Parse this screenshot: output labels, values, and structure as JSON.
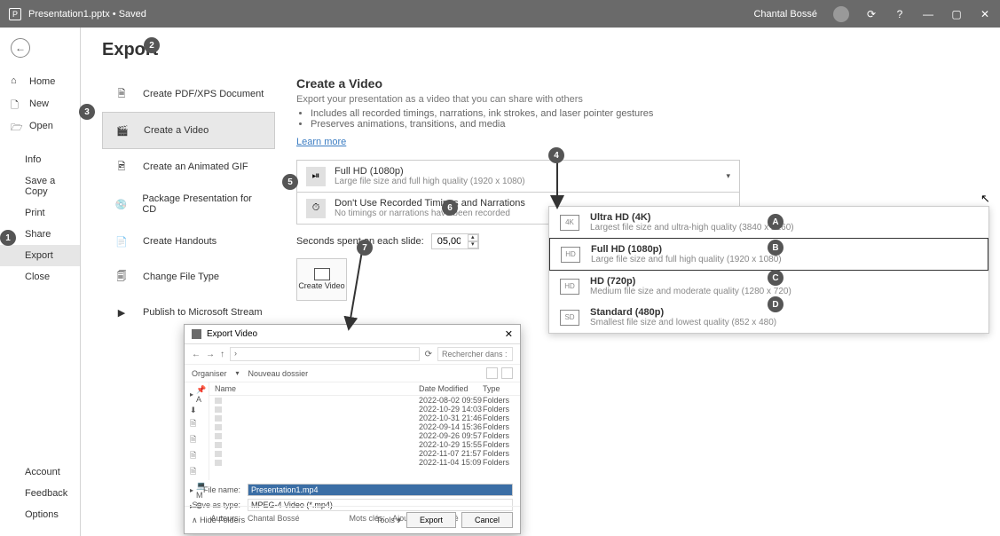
{
  "titlebar": {
    "doc_title": "Presentation1.pptx • Saved",
    "user_name": "Chantal Bossé"
  },
  "leftnav": {
    "home": "Home",
    "new": "New",
    "open": "Open",
    "info": "Info",
    "save_copy": "Save a Copy",
    "print": "Print",
    "share": "Share",
    "export": "Export",
    "close": "Close",
    "account": "Account",
    "feedback": "Feedback",
    "options": "Options"
  },
  "page_title": "Export",
  "export_options": {
    "pdf": "Create PDF/XPS Document",
    "video": "Create a Video",
    "gif": "Create an Animated GIF",
    "package": "Package Presentation for CD",
    "handouts": "Create Handouts",
    "filetype": "Change File Type",
    "stream": "Publish to Microsoft Stream"
  },
  "create_video": {
    "title": "Create a Video",
    "desc": "Export your presentation as a video that you can share with others",
    "bullet1": "Includes all recorded timings, narrations, ink strokes, and laser pointer gestures",
    "bullet2": "Preserves animations, transitions, and media",
    "learn_more": "Learn more",
    "dd1_title": "Full HD (1080p)",
    "dd1_sub": "Large file size and full high quality (1920 x 1080)",
    "dd2_title": "Don't Use Recorded Timings and Narrations",
    "dd2_sub": "No timings or narrations have been recorded",
    "seconds_label": "Seconds spent on each slide:",
    "seconds_value": "05,00",
    "create_btn": "Create Video"
  },
  "resolutions": {
    "uhd_title": "Ultra HD (4K)",
    "uhd_sub": "Largest file size and ultra-high quality (3840 x 2160)",
    "fhd_title": "Full HD (1080p)",
    "fhd_sub": "Large file size and full high quality (1920 x 1080)",
    "hd_title": "HD (720p)",
    "hd_sub": "Medium file size and moderate quality (1280 x 720)",
    "sd_title": "Standard (480p)",
    "sd_sub": "Smallest file size and lowest quality (852 x 480)"
  },
  "dialog": {
    "title": "Export Video",
    "search_placeholder": "Rechercher dans : PPT Best Pr...",
    "organize": "Organiser",
    "new_folder": "Nouveau dossier",
    "col_name": "Name",
    "col_date": "Date Modified",
    "col_type": "Type",
    "rows": [
      {
        "date": "2022-08-02 09:59",
        "type": "Folders"
      },
      {
        "date": "2022-10-29 14:03",
        "type": "Folders"
      },
      {
        "date": "2022-10-31 21:46",
        "type": "Folders"
      },
      {
        "date": "2022-09-14 15:36",
        "type": "Folders"
      },
      {
        "date": "2022-09-26 09:57",
        "type": "Folders"
      },
      {
        "date": "2022-10-29 15:55",
        "type": "Folders"
      },
      {
        "date": "2022-11-07 21:57",
        "type": "Folders"
      },
      {
        "date": "2022-11-04 15:09",
        "type": "Folders"
      }
    ],
    "filename_label": "File name:",
    "filename_value": "Presentation1.mp4",
    "savetype_label": "Save as type:",
    "savetype_value": "MPEG-4 Video (*.mp4)",
    "authors_label": "Auteurs:",
    "authors_value": "Chantal Bossé",
    "tags_label": "Mots clés:",
    "tags_value": "Ajoutez un mot-clé",
    "hide_folders": "Hide Folders",
    "tools": "Tools",
    "export_btn": "Export",
    "cancel_btn": "Cancel"
  },
  "markers": {
    "m1": "1",
    "m2": "2",
    "m3": "3",
    "m4": "4",
    "m5": "5",
    "m6": "6",
    "m7": "7",
    "mA": "A",
    "mB": "B",
    "mC": "C",
    "mD": "D"
  }
}
